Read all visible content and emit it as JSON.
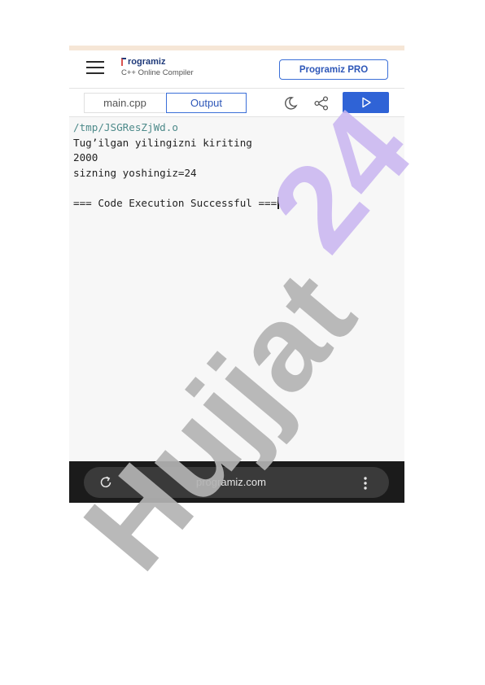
{
  "header": {
    "logo_title": "rogramiz",
    "logo_subtitle": "C++ Online Compiler",
    "pro_button": "Programiz PRO"
  },
  "toolbar": {
    "file_tab": "main.cpp",
    "output_tab": "Output",
    "icons": [
      "moon-icon",
      "share-icon",
      "run-icon"
    ]
  },
  "output": {
    "lines": [
      "/tmp/JSGResZjWd.o",
      "Tug’ilgan yilingizni kiriting",
      "2000",
      "sizning yoshingiz=24",
      "",
      "=== Code Execution Successful ==="
    ]
  },
  "browser": {
    "url": "programiz.com",
    "icons": [
      "reload-icon",
      "kebab-menu-icon"
    ]
  },
  "watermark": {
    "text": "Hujjat 24"
  },
  "colors": {
    "accent": "#2f63d6",
    "watermark_gray": "#b3b3b3",
    "watermark_purple": "#c9b6f0"
  }
}
